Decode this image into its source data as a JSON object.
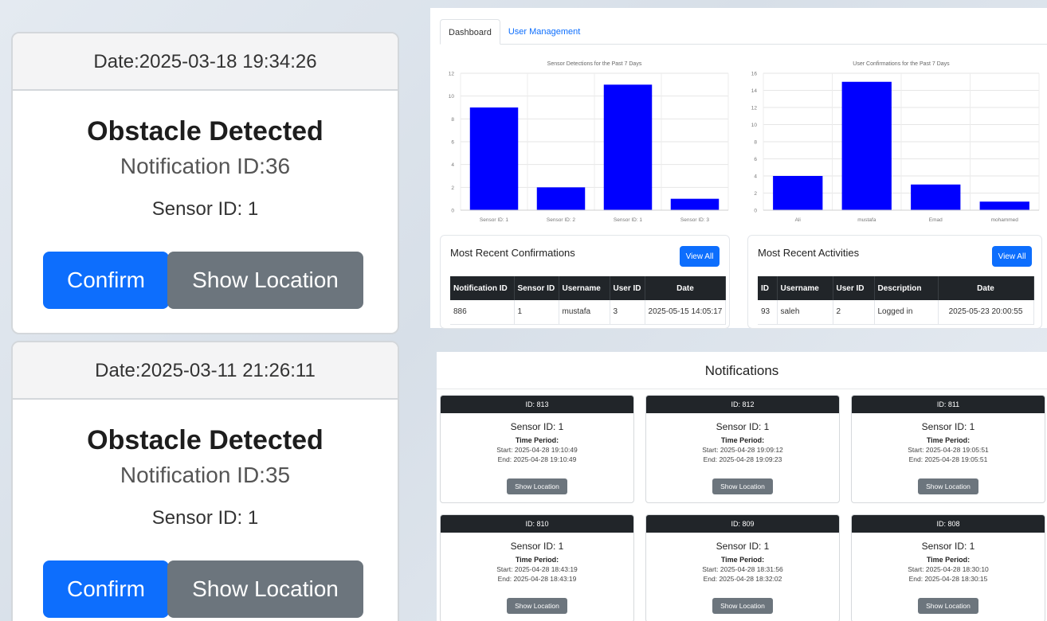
{
  "left_cards": [
    {
      "date": "Date:2025-03-18 19:34:26",
      "title": "Obstacle Detected",
      "notification": "Notification ID:36",
      "sensor": "Sensor ID: 1",
      "confirm": "Confirm",
      "show_location": "Show Location"
    },
    {
      "date": "Date:2025-03-11 21:26:11",
      "title": "Obstacle Detected",
      "notification": "Notification ID:35",
      "sensor": "Sensor ID: 1",
      "confirm": "Confirm",
      "show_location": "Show Location"
    }
  ],
  "dashboard": {
    "tabs": [
      "Dashboard",
      "User Management"
    ],
    "confirmations": {
      "title": "Most Recent Confirmations",
      "view_all": "View All",
      "columns": [
        "Notification ID",
        "Sensor ID",
        "Username",
        "User ID",
        "Date"
      ],
      "rows": [
        [
          "886",
          "1",
          "mustafa",
          "3",
          "2025-05-15 14:05:17"
        ]
      ]
    },
    "activities": {
      "title": "Most Recent Activities",
      "view_all": "View All",
      "columns": [
        "ID",
        "Username",
        "User ID",
        "Description",
        "Date"
      ],
      "rows": [
        [
          "93",
          "saleh",
          "2",
          "Logged in",
          "2025-05-23 20:00:55"
        ]
      ]
    }
  },
  "chart_data": [
    {
      "type": "bar",
      "title": "Sensor Detections for the Past 7 Days",
      "categories": [
        "Sensor ID: 1",
        "Sensor ID: 2",
        "Sensor ID: 1",
        "Sensor ID: 3"
      ],
      "values": [
        9,
        2,
        11,
        1
      ],
      "ylim": [
        0,
        12
      ],
      "yticks": [
        0,
        2,
        4,
        6,
        8,
        10,
        12
      ],
      "color": "#0000ff",
      "grid": true
    },
    {
      "type": "bar",
      "title": "User Confirmations for the Past 7 Days",
      "categories": [
        "Ali",
        "mustafa",
        "Emad",
        "mohammed"
      ],
      "values": [
        4,
        15,
        3,
        1
      ],
      "ylim": [
        0,
        16
      ],
      "yticks": [
        0,
        2,
        4,
        6,
        8,
        10,
        12,
        14,
        16
      ],
      "color": "#0000ff",
      "grid": true
    }
  ],
  "notifications": {
    "title": "Notifications",
    "time_period_label": "Time Period:",
    "button": "Show Location",
    "items": [
      {
        "id": "ID: 813",
        "sensor": "Sensor ID: 1",
        "start": "Start: 2025-04-28 19:10:49",
        "end": "End: 2025-04-28 19:10:49"
      },
      {
        "id": "ID: 812",
        "sensor": "Sensor ID: 1",
        "start": "Start: 2025-04-28 19:09:12",
        "end": "End: 2025-04-28 19:09:23"
      },
      {
        "id": "ID: 811",
        "sensor": "Sensor ID: 1",
        "start": "Start: 2025-04-28 19:05:51",
        "end": "End: 2025-04-28 19:05:51"
      },
      {
        "id": "ID: 810",
        "sensor": "Sensor ID: 1",
        "start": "Start: 2025-04-28 18:43:19",
        "end": "End: 2025-04-28 18:43:19"
      },
      {
        "id": "ID: 809",
        "sensor": "Sensor ID: 1",
        "start": "Start: 2025-04-28 18:31:56",
        "end": "End: 2025-04-28 18:32:02"
      },
      {
        "id": "ID: 808",
        "sensor": "Sensor ID: 1",
        "start": "Start: 2025-04-28 18:30:10",
        "end": "End: 2025-04-28 18:30:15"
      }
    ]
  }
}
